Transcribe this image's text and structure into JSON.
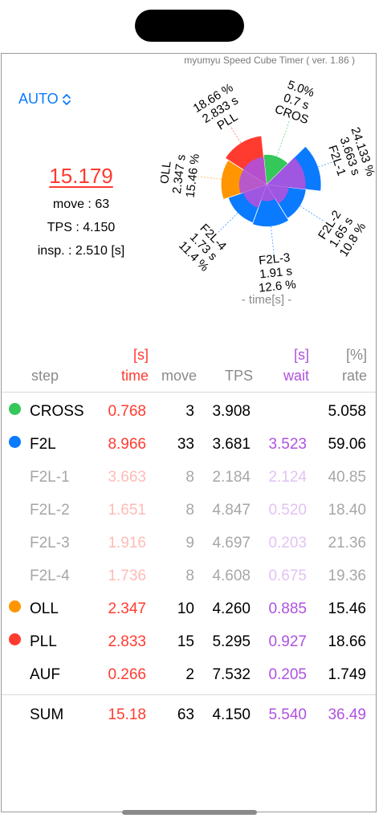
{
  "app": {
    "title": "myumyu Speed Cube Timer ( ver. 1.86 )"
  },
  "mode": {
    "label": "AUTO"
  },
  "summary": {
    "total": "15.179",
    "move": "move : 63",
    "tps": "TPS : 4.150",
    "insp": "insp. : 2.510 [s]"
  },
  "chart_data": {
    "type": "pie",
    "title": "",
    "axis_caption": "- time[s] -",
    "slices": [
      {
        "name": "CROS",
        "lines": [
          "5.0%",
          "0.7 s",
          "CROS"
        ],
        "time": 0.768,
        "rate": 5.058,
        "color": "#34c759"
      },
      {
        "name": "F2L-1",
        "lines": [
          "24.133 %",
          "3.663 s",
          "F2L-1"
        ],
        "time": 3.663,
        "rate": 24.133,
        "color": "#0a7aff"
      },
      {
        "name": "F2L-2",
        "lines": [
          "F2L-2",
          "1.65 s",
          "10.8 %"
        ],
        "time": 1.651,
        "rate": 10.8,
        "color": "#0a7aff"
      },
      {
        "name": "F2L-3",
        "lines": [
          "F2L-3",
          "1.91 s",
          "12.6 %"
        ],
        "time": 1.916,
        "rate": 12.6,
        "color": "#0a7aff"
      },
      {
        "name": "F2L-4",
        "lines": [
          "F2L-4",
          "1.73 s",
          "11.4 %"
        ],
        "time": 1.736,
        "rate": 11.4,
        "color": "#0a7aff"
      },
      {
        "name": "OLL",
        "lines": [
          "OLL",
          "2.347 s",
          "15.46 %"
        ],
        "time": 2.347,
        "rate": 15.46,
        "color": "#ff9500"
      },
      {
        "name": "PLL",
        "lines": [
          "18.66 %",
          "2.833 s",
          "PLL"
        ],
        "time": 2.833,
        "rate": 18.66,
        "color": "#ff3b30"
      }
    ],
    "wait_color": "#af52de"
  },
  "table": {
    "headers": {
      "step": "step",
      "time_unit": "[s]",
      "time": "time",
      "move": "move",
      "tps": "TPS",
      "wait_unit": "[s]",
      "wait": "wait",
      "rate_unit": "[%]",
      "rate": "rate"
    },
    "rows": [
      {
        "step": "CROSS",
        "time": "0.768",
        "move": "3",
        "tps": "3.908",
        "wait": "",
        "rate": "5.058",
        "dot": "#34c759",
        "sub": false
      },
      {
        "step": "F2L",
        "time": "8.966",
        "move": "33",
        "tps": "3.681",
        "wait": "3.523",
        "rate": "59.06",
        "dot": "#0a7aff",
        "sub": false
      },
      {
        "step": "F2L-1",
        "time": "3.663",
        "move": "8",
        "tps": "2.184",
        "wait": "2.124",
        "rate": "40.85",
        "dot": "",
        "sub": true
      },
      {
        "step": "F2L-2",
        "time": "1.651",
        "move": "8",
        "tps": "4.847",
        "wait": "0.520",
        "rate": "18.40",
        "dot": "",
        "sub": true
      },
      {
        "step": "F2L-3",
        "time": "1.916",
        "move": "9",
        "tps": "4.697",
        "wait": "0.203",
        "rate": "21.36",
        "dot": "",
        "sub": true
      },
      {
        "step": "F2L-4",
        "time": "1.736",
        "move": "8",
        "tps": "4.608",
        "wait": "0.675",
        "rate": "19.36",
        "dot": "",
        "sub": true
      },
      {
        "step": "OLL",
        "time": "2.347",
        "move": "10",
        "tps": "4.260",
        "wait": "0.885",
        "rate": "15.46",
        "dot": "#ff9500",
        "sub": false
      },
      {
        "step": "PLL",
        "time": "2.833",
        "move": "15",
        "tps": "5.295",
        "wait": "0.927",
        "rate": "18.66",
        "dot": "#ff3b30",
        "sub": false
      },
      {
        "step": "AUF",
        "time": "0.266",
        "move": "2",
        "tps": "7.532",
        "wait": "0.205",
        "rate": "1.749",
        "dot": "",
        "sub": false
      }
    ],
    "sum": {
      "step": "SUM",
      "time": "15.18",
      "move": "63",
      "tps": "4.150",
      "wait": "5.540",
      "rate": "36.49"
    }
  }
}
